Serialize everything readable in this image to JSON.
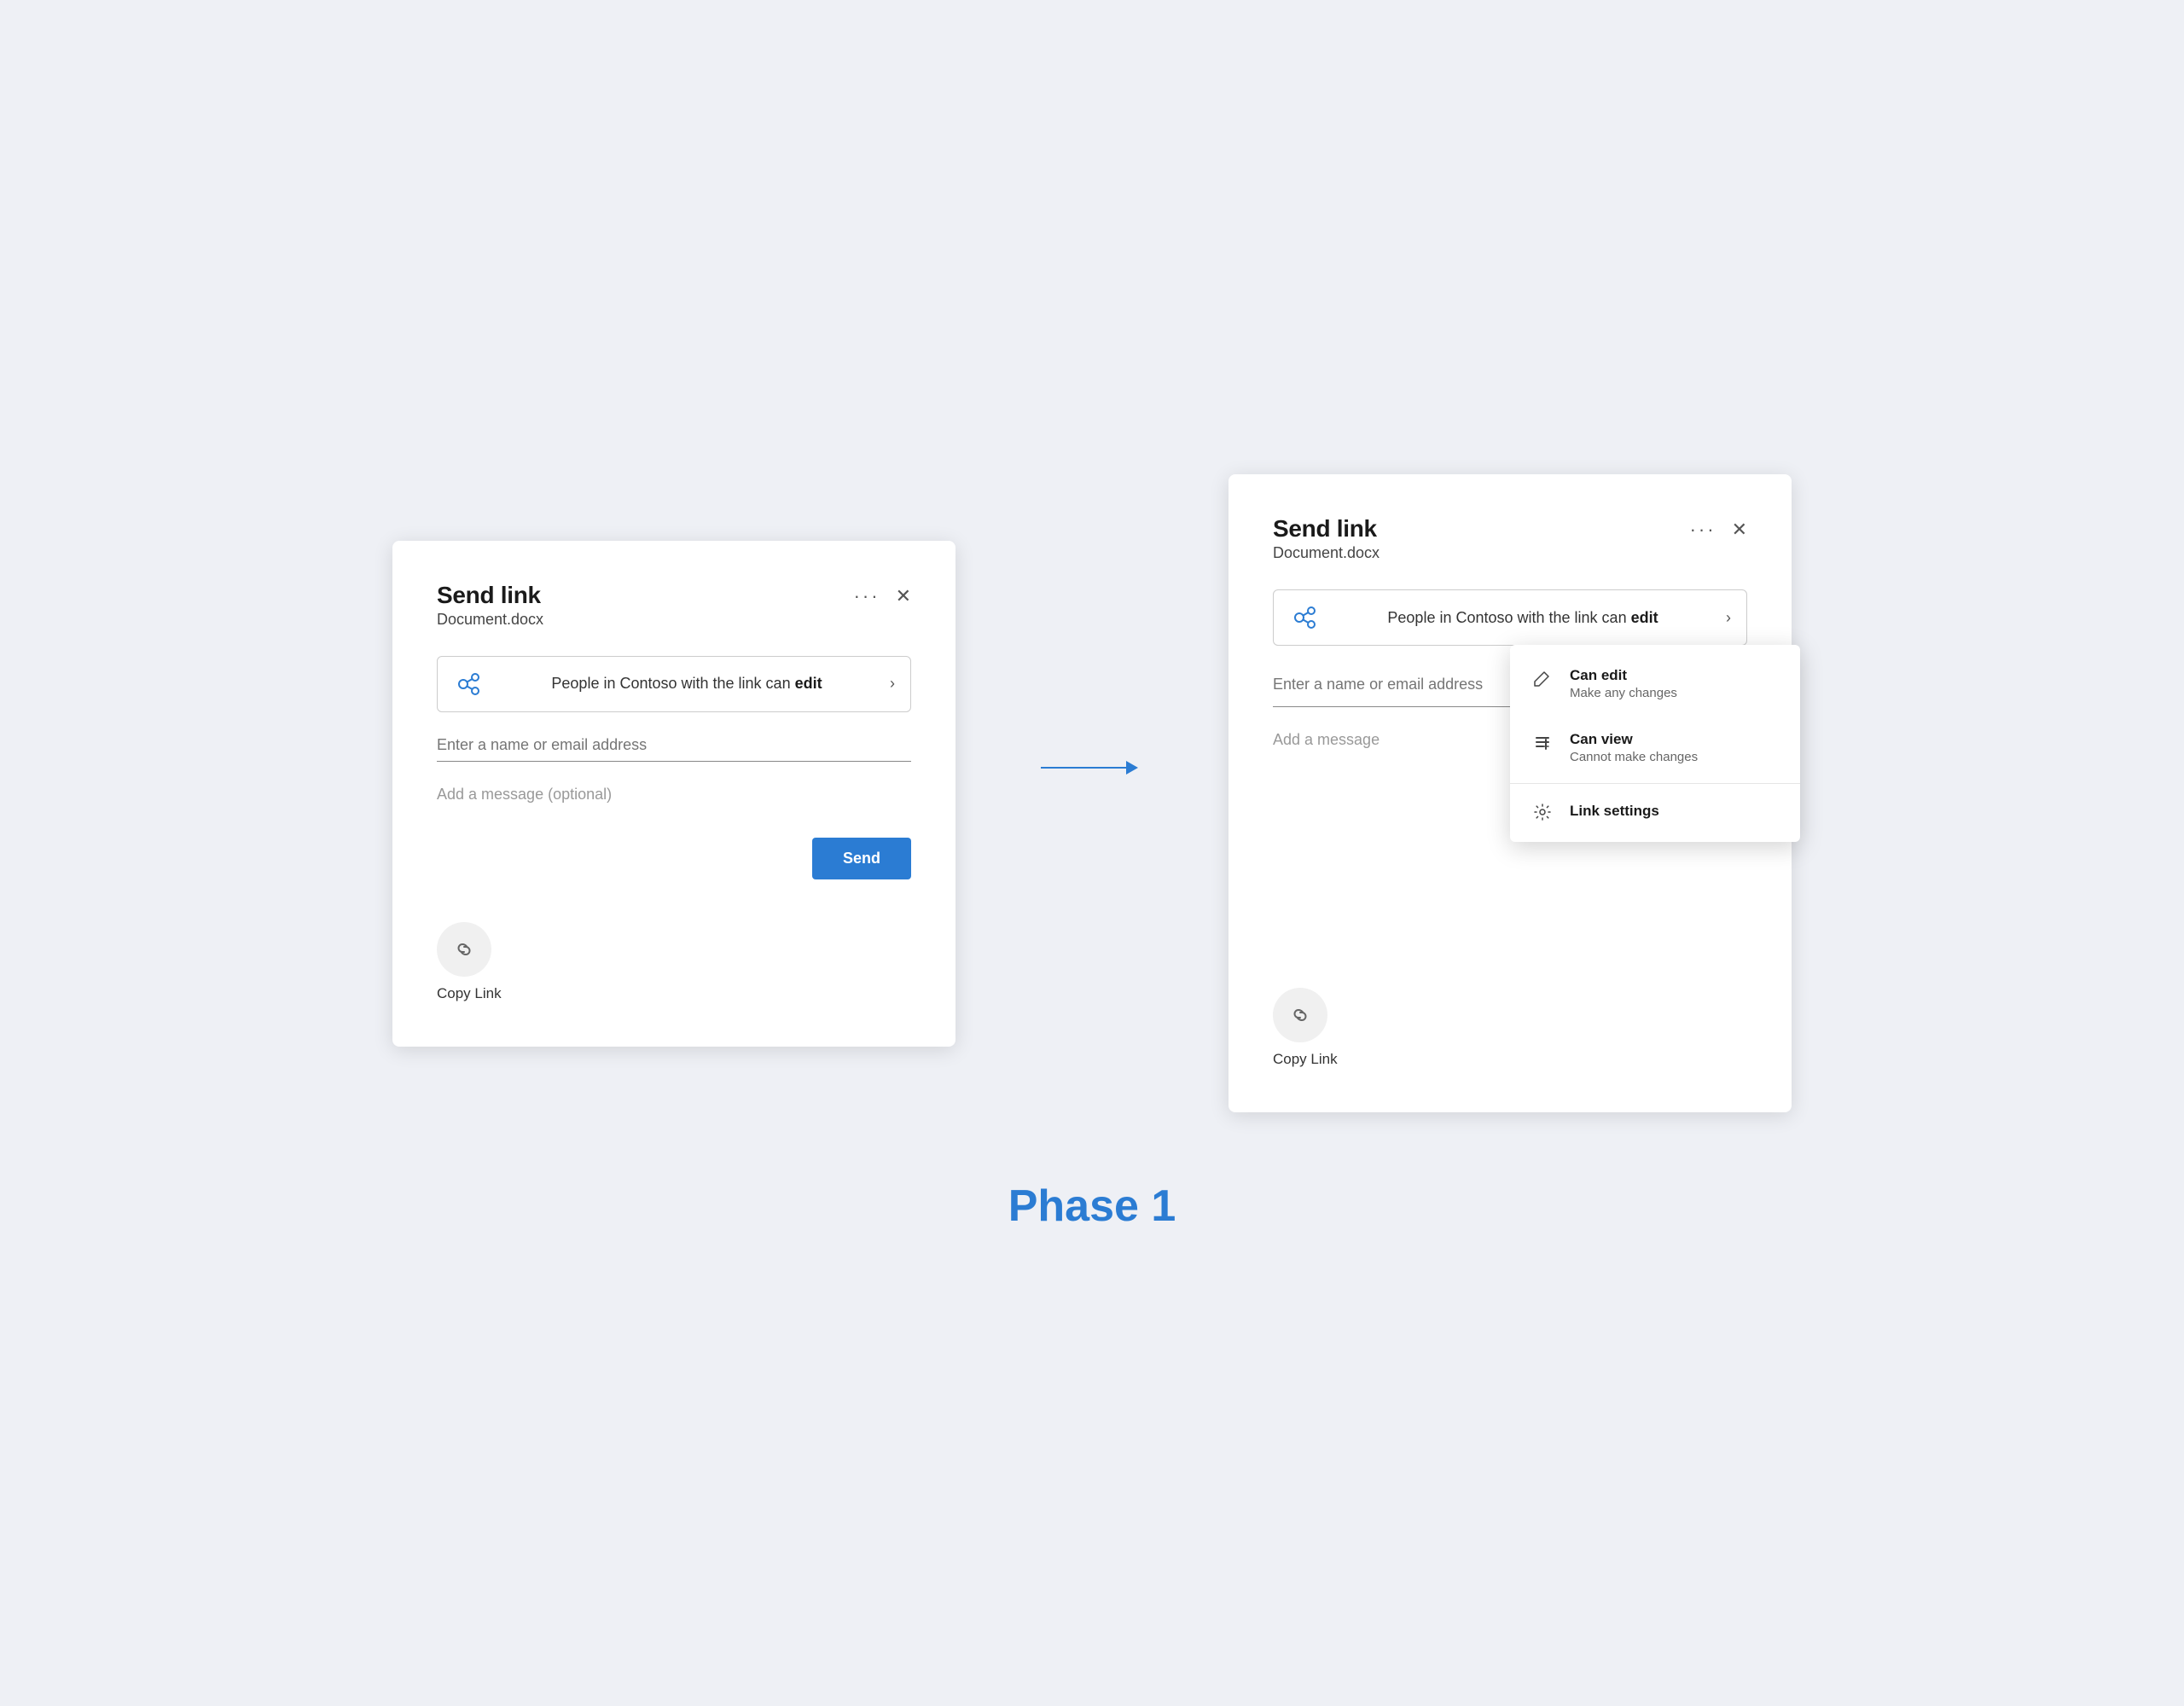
{
  "page": {
    "background": "#eef0f5"
  },
  "phase_label": "Phase 1",
  "arrow": {
    "color": "#2B7CD3"
  },
  "dialog_left": {
    "title": "Send link",
    "subtitle": "Document.docx",
    "dots_label": "···",
    "close_label": "✕",
    "permission_text_before": "People in Contoso with the link can ",
    "permission_text_bold": "edit",
    "email_placeholder": "Enter a name or email address",
    "message_placeholder": "Add a message (optional)",
    "send_button_label": "Send",
    "copy_link_label": "Copy Link"
  },
  "dialog_right": {
    "title": "Send link",
    "subtitle": "Document.docx",
    "dots_label": "···",
    "close_label": "✕",
    "permission_text_before": "People in Contoso with the link can ",
    "permission_text_bold": "edit",
    "email_placeholder": "Enter a name or email address",
    "message_placeholder": "Add a message",
    "copy_link_label": "Copy Link"
  },
  "dropdown": {
    "can_edit_title": "Can edit",
    "can_edit_desc": "Make any changes",
    "can_view_title": "Can view",
    "can_view_desc": "Cannot make changes",
    "link_settings_label": "Link settings"
  }
}
